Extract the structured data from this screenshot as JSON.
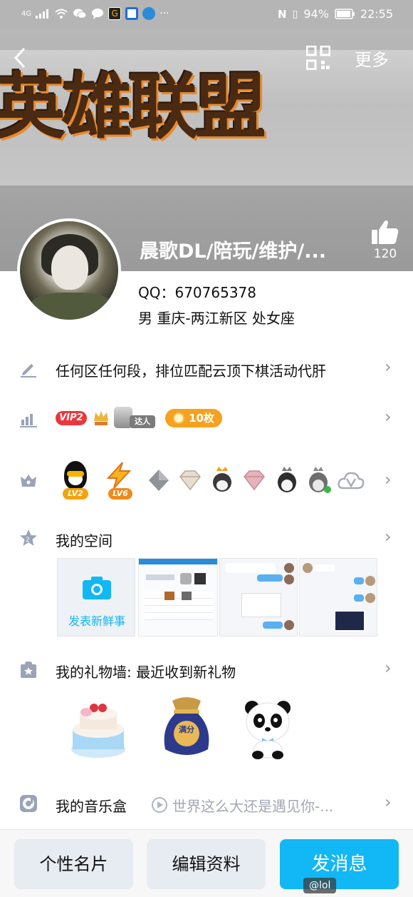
{
  "status_bar": {
    "signal": "4G",
    "battery_pct": "94%",
    "time": "22:55",
    "more": "···"
  },
  "nav": {
    "more_label": "更多"
  },
  "banner": {
    "text": "英雄联盟"
  },
  "profile": {
    "name": "晨歌DL/陪玩/维护/...",
    "likes": "120",
    "qq": "QQ：670765378",
    "info": "男  重庆-两江新区  处女座"
  },
  "rows": {
    "signature": "任何区任何段，排位匹配云顶下棋活动代肝",
    "vip_badge": "VIP2",
    "daren_badge": "达人",
    "coins_badge": "10枚",
    "lv_badge_1": "LV2",
    "lv_badge_2": "LV6",
    "space_title": "我的空间",
    "space_post_label": "发表新鲜事",
    "gift_title": "我的礼物墙: 最近收到新礼物",
    "gift_bag_text": "满分",
    "music_title": "我的音乐盒",
    "music_song": "世界这么大还是遇见你-..."
  },
  "bottom": {
    "card_label": "个性名片",
    "edit_label": "编辑资料",
    "message_label": "发消息",
    "watermark": "@lol"
  },
  "colors": {
    "accent": "#12b7f5",
    "vip_red": "#e8383d",
    "coin_orange": "#f6a21e",
    "icon_gray": "#9aa3b8"
  }
}
